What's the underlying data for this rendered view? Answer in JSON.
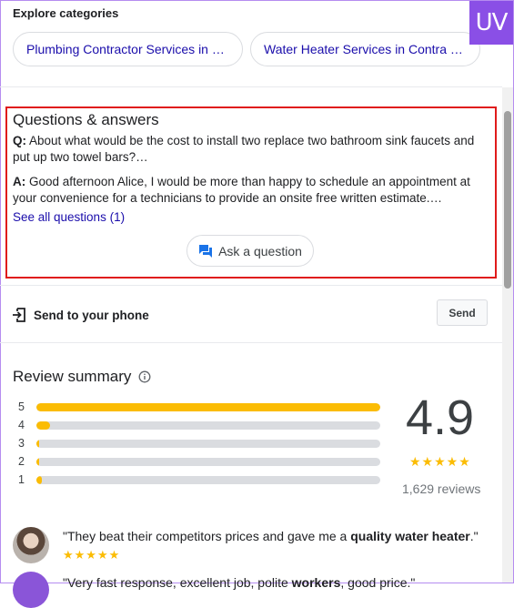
{
  "explore": {
    "title": "Explore categories",
    "chips": [
      "Plumbing Contractor Services in …",
      "Water Heater Services in Contra …"
    ]
  },
  "qa": {
    "title": "Questions & answers",
    "question_prefix": "Q:",
    "question": "About what would be the cost to install two replace two bathroom sink faucets and put up two towel bars?…",
    "answer_prefix": "A:",
    "answer": "Good afternoon Alice, I would be more than happy to schedule an appointment at your convenience for a technicians to provide an onsite free written estimate.…",
    "see_all": "See all questions (1)",
    "ask_label": "Ask a question"
  },
  "send_phone": {
    "label": "Send to your phone",
    "button": "Send"
  },
  "review_summary": {
    "title": "Review summary",
    "rating": "4.9",
    "stars": "★★★★★",
    "count": "1,629 reviews",
    "bars": [
      {
        "label": "5",
        "fraction": 1.0
      },
      {
        "label": "4",
        "fraction": 0.04
      },
      {
        "label": "3",
        "fraction": 0.005
      },
      {
        "label": "2",
        "fraction": 0.005
      },
      {
        "label": "1",
        "fraction": 0.015
      }
    ]
  },
  "reviews": [
    {
      "pre": "\"They beat their competitors prices and gave me a ",
      "bold": "quality water heater",
      "post": ".\"",
      "stars": "★★★★★"
    },
    {
      "pre": "\"Very fast response, excellent job, polite ",
      "bold": "workers",
      "post": ", good price.\""
    }
  ],
  "brand": {
    "logo": "UV",
    "accent": "#8a4fe6"
  },
  "colors": {
    "link": "#1a0dab",
    "star": "#fbbc04",
    "highlight_border": "#e01b1b"
  }
}
